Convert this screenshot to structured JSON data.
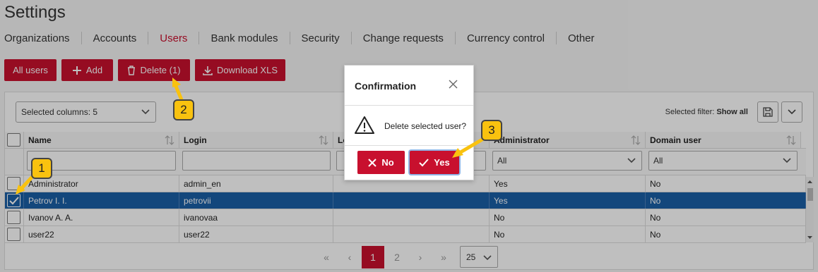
{
  "page_title": "Settings",
  "nav": [
    "Organizations",
    "Accounts",
    "Users",
    "Bank modules",
    "Security",
    "Change requests",
    "Currency control",
    "Other"
  ],
  "toolbar": {
    "all_users": "All users",
    "add": "Add",
    "delete": "Delete (1)",
    "download": "Download XLS"
  },
  "columns_select": "Selected columns: 5",
  "selected_filter_label": "Selected filter:",
  "selected_filter_value": "Show all",
  "headers": [
    "Name",
    "Login",
    "Lo",
    "Administrator",
    "Domain user"
  ],
  "filter_all": "All",
  "rows": [
    {
      "name": "Administrator",
      "login": "admin_en",
      "admin": "Yes",
      "domain": "No"
    },
    {
      "name": "Petrov I. I.",
      "login": "petrovii",
      "admin": "Yes",
      "domain": "No"
    },
    {
      "name": "Ivanov A. A.",
      "login": "ivanovaa",
      "admin": "No",
      "domain": "No"
    },
    {
      "name": "user22",
      "login": "user22",
      "admin": "No",
      "domain": "No"
    }
  ],
  "pagination": {
    "first": "«",
    "prev": "‹",
    "pages": [
      "1",
      "2"
    ],
    "next": "›",
    "last": "»",
    "page_size": "25"
  },
  "dialog": {
    "title": "Confirmation",
    "message": "Delete selected user?",
    "no": "No",
    "yes": "Yes"
  },
  "callouts": [
    "1",
    "2",
    "3"
  ],
  "colors": {
    "accent": "#c8102e",
    "selected_row": "#1a5fa6",
    "callout": "#f9c20f"
  }
}
